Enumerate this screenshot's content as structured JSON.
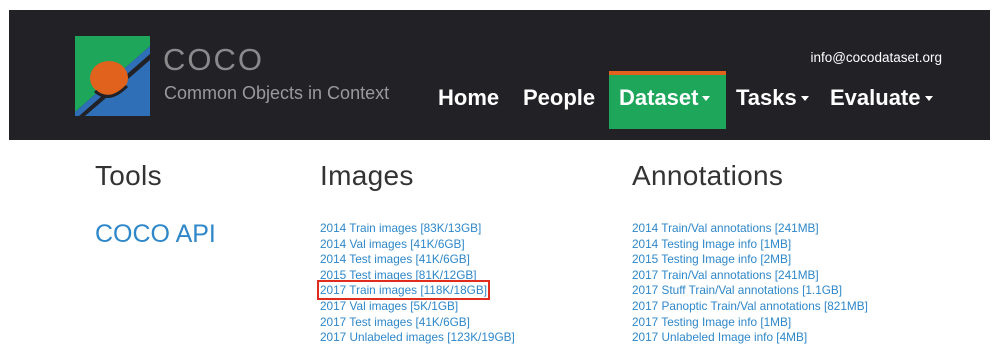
{
  "header": {
    "brand_name": "COCO",
    "brand_tagline": "Common Objects in Context",
    "email": "info@cocodataset.org",
    "nav": {
      "home": "Home",
      "people": "People",
      "dataset": "Dataset",
      "tasks": "Tasks",
      "evaluate": "Evaluate"
    },
    "active_nav": "Dataset"
  },
  "sections": {
    "tools": {
      "heading": "Tools",
      "links": [
        "COCO API"
      ]
    },
    "images": {
      "heading": "Images",
      "links": [
        "2014 Train images [83K/13GB]",
        "2014 Val images [41K/6GB]",
        "2014 Test images [41K/6GB]",
        "2015 Test images [81K/12GB]",
        "2017 Train images [118K/18GB]",
        "2017 Val images [5K/1GB]",
        "2017 Test images [41K/6GB]",
        "2017 Unlabeled images [123K/19GB]"
      ],
      "highlighted_link": "2017 Train images [118K/18GB]"
    },
    "annotations": {
      "heading": "Annotations",
      "links": [
        "2014 Train/Val annotations [241MB]",
        "2014 Testing Image info [1MB]",
        "2015 Testing Image info [2MB]",
        "2017 Train/Val annotations [241MB]",
        "2017 Stuff Train/Val annotations [1.1GB]",
        "2017 Panoptic Train/Val annotations [821MB]",
        "2017 Testing Image info [1MB]",
        "2017 Unlabeled Image info [4MB]"
      ]
    }
  },
  "colors": {
    "header_bg": "#212126",
    "active_tab_bg": "#1ea65a",
    "active_tab_top": "#e0621c",
    "link": "#2e87c9",
    "highlight_border": "#e02b1f",
    "logo_blue": "#2f6fb7",
    "logo_green": "#1ea65a",
    "logo_orange": "#e0621c"
  }
}
